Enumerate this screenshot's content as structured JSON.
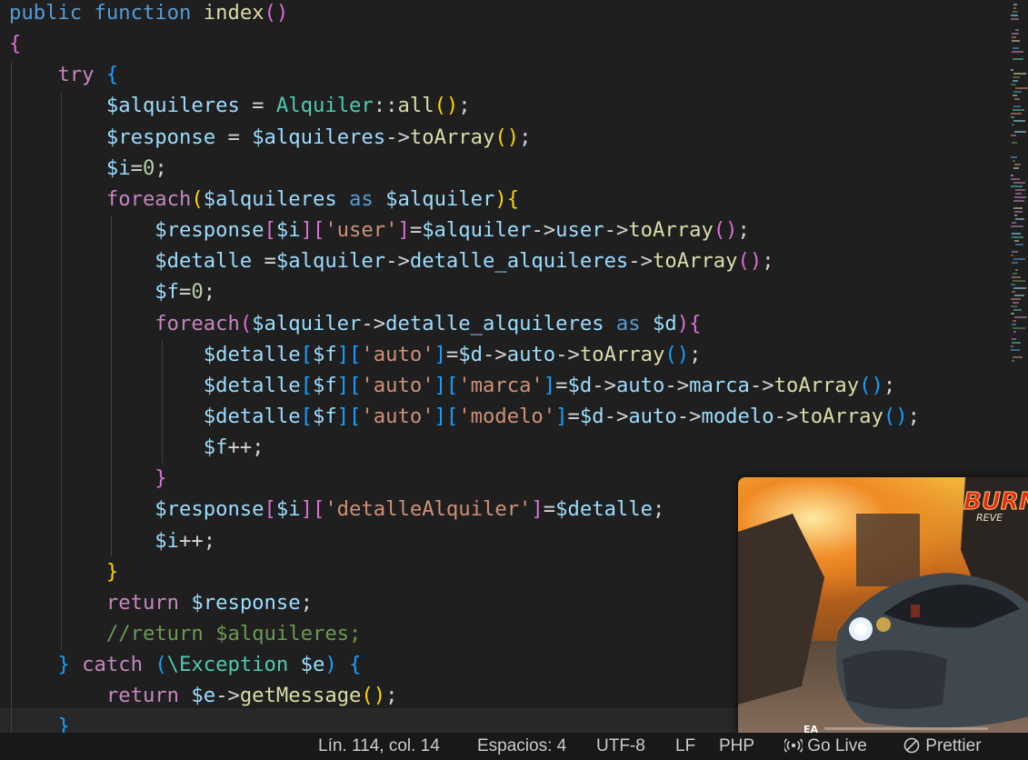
{
  "editor": {
    "lines": [
      [
        {
          "t": "public ",
          "c": "kw"
        },
        {
          "t": "function ",
          "c": "kw"
        },
        {
          "t": "index",
          "c": "fn"
        },
        {
          "t": "()",
          "c": "b2"
        }
      ],
      [
        {
          "t": "{",
          "c": "b2"
        }
      ],
      [
        {
          "t": "    "
        },
        {
          "t": "try ",
          "c": "ctl"
        },
        {
          "t": "{",
          "c": "b3"
        }
      ],
      [
        {
          "t": "        "
        },
        {
          "t": "$alquileres",
          "c": "var"
        },
        {
          "t": " = ",
          "c": "op"
        },
        {
          "t": "Alquiler",
          "c": "cls"
        },
        {
          "t": "::",
          "c": "op"
        },
        {
          "t": "all",
          "c": "fn"
        },
        {
          "t": "()",
          "c": "b1"
        },
        {
          "t": ";",
          "c": "op"
        }
      ],
      [
        {
          "t": "        "
        },
        {
          "t": "$response",
          "c": "var"
        },
        {
          "t": " = ",
          "c": "op"
        },
        {
          "t": "$alquileres",
          "c": "var"
        },
        {
          "t": "->",
          "c": "op"
        },
        {
          "t": "toArray",
          "c": "fn"
        },
        {
          "t": "()",
          "c": "b1"
        },
        {
          "t": ";",
          "c": "op"
        }
      ],
      [
        {
          "t": "        "
        },
        {
          "t": "$i",
          "c": "var"
        },
        {
          "t": "=",
          "c": "op"
        },
        {
          "t": "0",
          "c": "num"
        },
        {
          "t": ";",
          "c": "op"
        }
      ],
      [
        {
          "t": "        "
        },
        {
          "t": "foreach",
          "c": "ctl"
        },
        {
          "t": "(",
          "c": "b1"
        },
        {
          "t": "$alquileres",
          "c": "var"
        },
        {
          "t": " as ",
          "c": "kw"
        },
        {
          "t": "$alquiler",
          "c": "var"
        },
        {
          "t": ")",
          "c": "b1"
        },
        {
          "t": "{",
          "c": "b1"
        }
      ],
      [
        {
          "t": "            "
        },
        {
          "t": "$response",
          "c": "var"
        },
        {
          "t": "[",
          "c": "b2"
        },
        {
          "t": "$i",
          "c": "var"
        },
        {
          "t": "]",
          "c": "b2"
        },
        {
          "t": "[",
          "c": "b2"
        },
        {
          "t": "'user'",
          "c": "str"
        },
        {
          "t": "]",
          "c": "b2"
        },
        {
          "t": "=",
          "c": "op"
        },
        {
          "t": "$alquiler",
          "c": "var"
        },
        {
          "t": "->",
          "c": "op"
        },
        {
          "t": "user",
          "c": "var"
        },
        {
          "t": "->",
          "c": "op"
        },
        {
          "t": "toArray",
          "c": "fn"
        },
        {
          "t": "()",
          "c": "b2"
        },
        {
          "t": ";",
          "c": "op"
        }
      ],
      [
        {
          "t": "            "
        },
        {
          "t": "$detalle",
          "c": "var"
        },
        {
          "t": " =",
          "c": "op"
        },
        {
          "t": "$alquiler",
          "c": "var"
        },
        {
          "t": "->",
          "c": "op"
        },
        {
          "t": "detalle_alquileres",
          "c": "var"
        },
        {
          "t": "->",
          "c": "op"
        },
        {
          "t": "toArray",
          "c": "fn"
        },
        {
          "t": "()",
          "c": "b2"
        },
        {
          "t": ";",
          "c": "op"
        }
      ],
      [
        {
          "t": "            "
        },
        {
          "t": "$f",
          "c": "var"
        },
        {
          "t": "=",
          "c": "op"
        },
        {
          "t": "0",
          "c": "num"
        },
        {
          "t": ";",
          "c": "op"
        }
      ],
      [
        {
          "t": "            "
        },
        {
          "t": "foreach",
          "c": "ctl"
        },
        {
          "t": "(",
          "c": "b2"
        },
        {
          "t": "$alquiler",
          "c": "var"
        },
        {
          "t": "->",
          "c": "op"
        },
        {
          "t": "detalle_alquileres",
          "c": "var"
        },
        {
          "t": " as ",
          "c": "kw"
        },
        {
          "t": "$d",
          "c": "var"
        },
        {
          "t": ")",
          "c": "b2"
        },
        {
          "t": "{",
          "c": "b2"
        }
      ],
      [
        {
          "t": "                "
        },
        {
          "t": "$detalle",
          "c": "var"
        },
        {
          "t": "[",
          "c": "b3"
        },
        {
          "t": "$f",
          "c": "var"
        },
        {
          "t": "]",
          "c": "b3"
        },
        {
          "t": "[",
          "c": "b3"
        },
        {
          "t": "'auto'",
          "c": "str"
        },
        {
          "t": "]",
          "c": "b3"
        },
        {
          "t": "=",
          "c": "op"
        },
        {
          "t": "$d",
          "c": "var"
        },
        {
          "t": "->",
          "c": "op"
        },
        {
          "t": "auto",
          "c": "var"
        },
        {
          "t": "->",
          "c": "op"
        },
        {
          "t": "toArray",
          "c": "fn"
        },
        {
          "t": "()",
          "c": "b3"
        },
        {
          "t": ";",
          "c": "op"
        }
      ],
      [
        {
          "t": "                "
        },
        {
          "t": "$detalle",
          "c": "var"
        },
        {
          "t": "[",
          "c": "b3"
        },
        {
          "t": "$f",
          "c": "var"
        },
        {
          "t": "]",
          "c": "b3"
        },
        {
          "t": "[",
          "c": "b3"
        },
        {
          "t": "'auto'",
          "c": "str"
        },
        {
          "t": "]",
          "c": "b3"
        },
        {
          "t": "[",
          "c": "b3"
        },
        {
          "t": "'marca'",
          "c": "str"
        },
        {
          "t": "]",
          "c": "b3"
        },
        {
          "t": "=",
          "c": "op"
        },
        {
          "t": "$d",
          "c": "var"
        },
        {
          "t": "->",
          "c": "op"
        },
        {
          "t": "auto",
          "c": "var"
        },
        {
          "t": "->",
          "c": "op"
        },
        {
          "t": "marca",
          "c": "var"
        },
        {
          "t": "->",
          "c": "op"
        },
        {
          "t": "toArray",
          "c": "fn"
        },
        {
          "t": "()",
          "c": "b3"
        },
        {
          "t": ";",
          "c": "op"
        }
      ],
      [
        {
          "t": "                "
        },
        {
          "t": "$detalle",
          "c": "var"
        },
        {
          "t": "[",
          "c": "b3"
        },
        {
          "t": "$f",
          "c": "var"
        },
        {
          "t": "]",
          "c": "b3"
        },
        {
          "t": "[",
          "c": "b3"
        },
        {
          "t": "'auto'",
          "c": "str"
        },
        {
          "t": "]",
          "c": "b3"
        },
        {
          "t": "[",
          "c": "b3"
        },
        {
          "t": "'modelo'",
          "c": "str"
        },
        {
          "t": "]",
          "c": "b3"
        },
        {
          "t": "=",
          "c": "op"
        },
        {
          "t": "$d",
          "c": "var"
        },
        {
          "t": "->",
          "c": "op"
        },
        {
          "t": "auto",
          "c": "var"
        },
        {
          "t": "->",
          "c": "op"
        },
        {
          "t": "modelo",
          "c": "var"
        },
        {
          "t": "->",
          "c": "op"
        },
        {
          "t": "toArray",
          "c": "fn"
        },
        {
          "t": "()",
          "c": "b3"
        },
        {
          "t": ";",
          "c": "op"
        }
      ],
      [
        {
          "t": "                "
        },
        {
          "t": "$f",
          "c": "var"
        },
        {
          "t": "++;",
          "c": "op"
        }
      ],
      [
        {
          "t": "            "
        },
        {
          "t": "}",
          "c": "b2"
        }
      ],
      [
        {
          "t": "            "
        },
        {
          "t": "$response",
          "c": "var"
        },
        {
          "t": "[",
          "c": "b2"
        },
        {
          "t": "$i",
          "c": "var"
        },
        {
          "t": "]",
          "c": "b2"
        },
        {
          "t": "[",
          "c": "b2"
        },
        {
          "t": "'detalleAlquiler'",
          "c": "str"
        },
        {
          "t": "]",
          "c": "b2"
        },
        {
          "t": "=",
          "c": "op"
        },
        {
          "t": "$detalle",
          "c": "var"
        },
        {
          "t": ";",
          "c": "op"
        }
      ],
      [
        {
          "t": "            "
        },
        {
          "t": "$i",
          "c": "var"
        },
        {
          "t": "++;",
          "c": "op"
        }
      ],
      [
        {
          "t": "        "
        },
        {
          "t": "}",
          "c": "b1"
        }
      ],
      [
        {
          "t": "        "
        },
        {
          "t": "return ",
          "c": "ctl"
        },
        {
          "t": "$response",
          "c": "var"
        },
        {
          "t": ";",
          "c": "op"
        }
      ],
      [
        {
          "t": "        "
        },
        {
          "t": "//return $alquileres;",
          "c": "com"
        }
      ],
      [
        {
          "t": "    "
        },
        {
          "t": "} ",
          "c": "b3"
        },
        {
          "t": "catch ",
          "c": "ctl"
        },
        {
          "t": "(",
          "c": "b3"
        },
        {
          "t": "\\Exception ",
          "c": "cls"
        },
        {
          "t": "$e",
          "c": "var"
        },
        {
          "t": ") ",
          "c": "b3"
        },
        {
          "t": "{",
          "c": "b3"
        }
      ],
      [
        {
          "t": "        "
        },
        {
          "t": "return ",
          "c": "ctl"
        },
        {
          "t": "$e",
          "c": "var"
        },
        {
          "t": "->",
          "c": "op"
        },
        {
          "t": "getMessage",
          "c": "fn"
        },
        {
          "t": "()",
          "c": "b1"
        },
        {
          "t": ";",
          "c": "op"
        }
      ],
      [
        {
          "t": "    "
        },
        {
          "t": "}",
          "c": "b3"
        }
      ]
    ]
  },
  "statusbar": {
    "position": "Lín. 114, col. 14",
    "spaces": "Espacios: 4",
    "encoding": "UTF-8",
    "eol": "LF",
    "language": "PHP",
    "golive": "Go Live",
    "prettier": "Prettier",
    "golive_icon": "broadcast-icon",
    "prettier_icon": "no-entry-icon"
  },
  "pip": {
    "logo_text": "BURN",
    "logo_sub": "REVE",
    "publisher": "EA"
  },
  "colors": {
    "kw": "#569cd6",
    "ctl": "#c586c0",
    "fn": "#dcdcaa",
    "var": "#9cdcfe",
    "cls": "#4ec9b0",
    "str": "#ce9178",
    "num": "#b5cea8",
    "com": "#6a9955",
    "bracket1": "#ffd700",
    "bracket2": "#da70d6",
    "bracket3": "#179fff",
    "editor_bg": "#1f1f1f",
    "statusbar_bg": "#181818"
  }
}
